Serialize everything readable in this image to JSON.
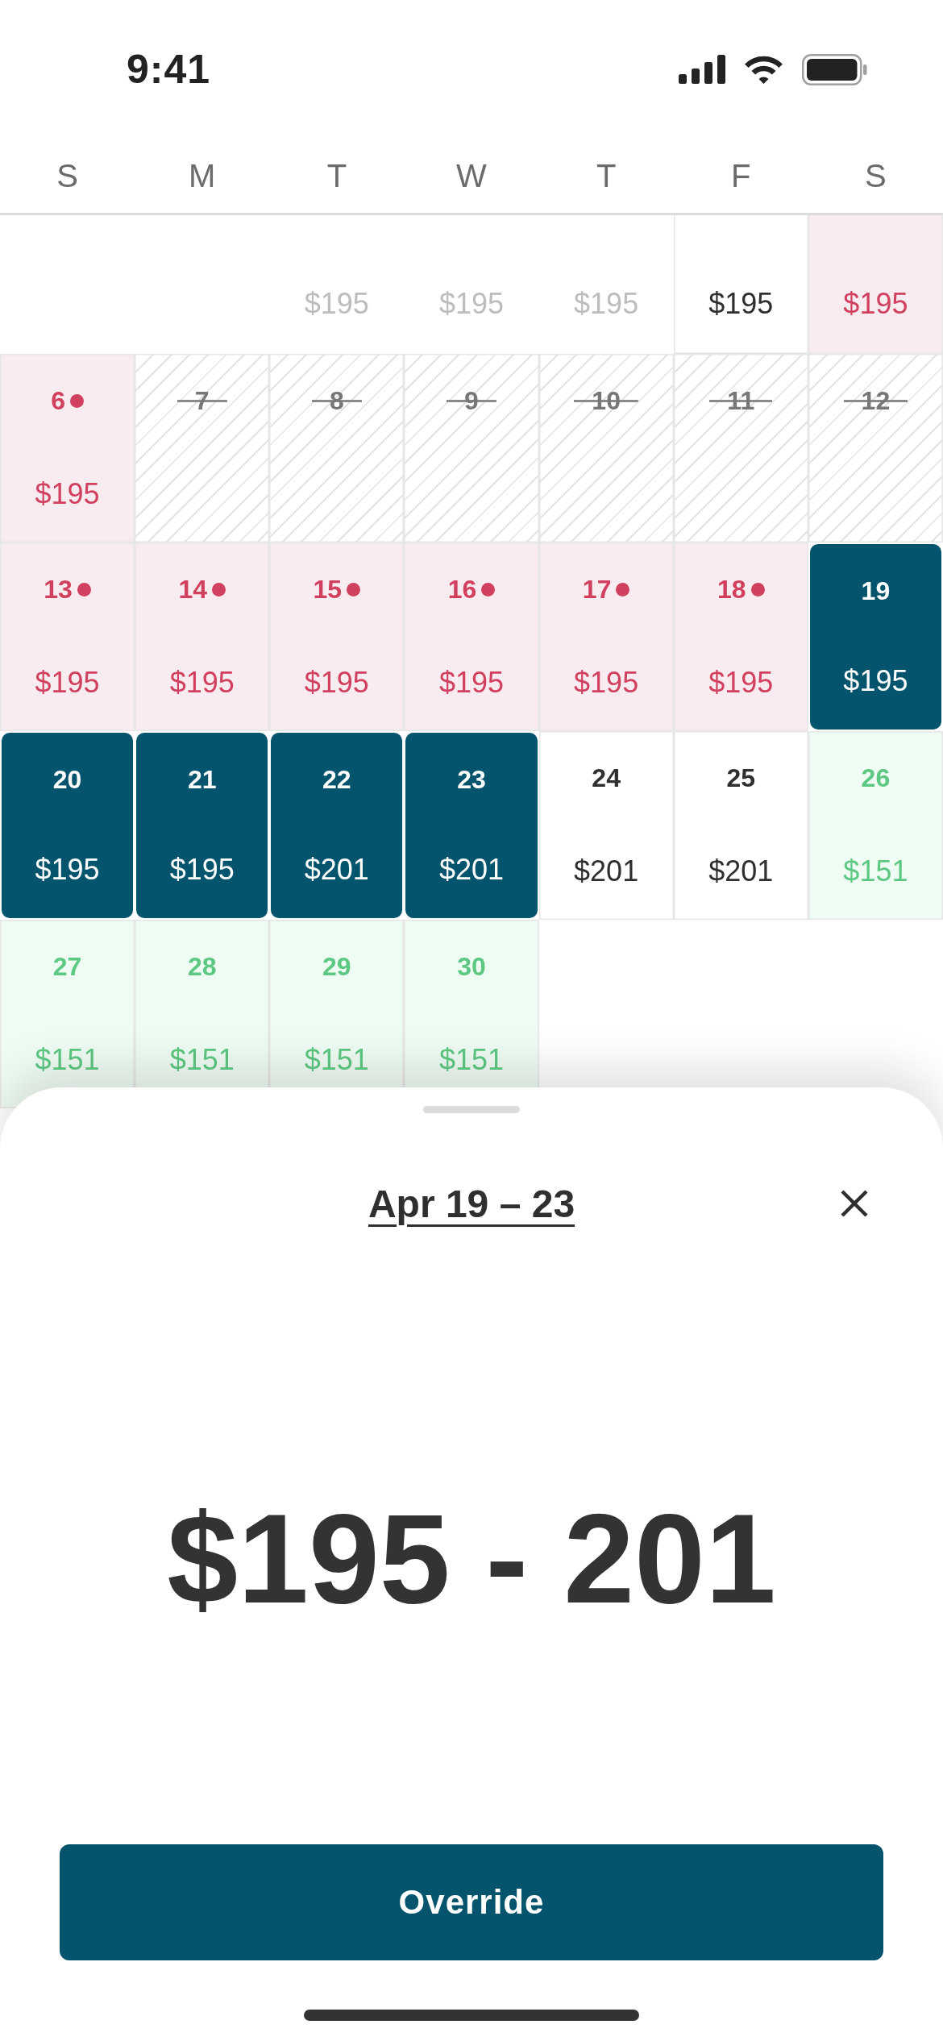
{
  "status_bar": {
    "time": "9:41"
  },
  "weekdays": [
    "S",
    "M",
    "T",
    "W",
    "T",
    "F",
    "S"
  ],
  "calendar": {
    "weeks": [
      [
        {
          "price": "$195",
          "kind": "past",
          "selected": false
        },
        {
          "price": "$195",
          "kind": "past",
          "selected": false
        },
        {
          "price": "$195",
          "kind": "past",
          "selected": false
        },
        {
          "price": "$195",
          "kind": "open",
          "selected": false
        },
        {
          "price": "$195",
          "kind": "booked",
          "selected": false
        }
      ],
      [
        {
          "day": "6",
          "price": "$195",
          "kind": "booked",
          "selected": false
        },
        {
          "day": "7",
          "kind": "blocked",
          "selected": false
        },
        {
          "day": "8",
          "kind": "blocked",
          "selected": false
        },
        {
          "day": "9",
          "kind": "blocked",
          "selected": false
        },
        {
          "day": "10",
          "kind": "blocked",
          "selected": false
        },
        {
          "day": "11",
          "kind": "blocked",
          "selected": false
        },
        {
          "day": "12",
          "kind": "blocked",
          "selected": false
        }
      ],
      [
        {
          "day": "13",
          "price": "$195",
          "kind": "booked",
          "selected": false
        },
        {
          "day": "14",
          "price": "$195",
          "kind": "booked",
          "selected": false
        },
        {
          "day": "15",
          "price": "$195",
          "kind": "booked",
          "selected": false
        },
        {
          "day": "16",
          "price": "$195",
          "kind": "booked",
          "selected": false
        },
        {
          "day": "17",
          "price": "$195",
          "kind": "booked",
          "selected": false
        },
        {
          "day": "18",
          "price": "$195",
          "kind": "booked",
          "selected": false
        },
        {
          "day": "19",
          "price": "$195",
          "kind": "open",
          "selected": true
        }
      ],
      [
        {
          "day": "20",
          "price": "$195",
          "kind": "open",
          "selected": true
        },
        {
          "day": "21",
          "price": "$195",
          "kind": "open",
          "selected": true
        },
        {
          "day": "22",
          "price": "$201",
          "kind": "open",
          "selected": true
        },
        {
          "day": "23",
          "price": "$201",
          "kind": "open",
          "selected": true
        },
        {
          "day": "24",
          "price": "$201",
          "kind": "open",
          "selected": false
        },
        {
          "day": "25",
          "price": "$201",
          "kind": "open",
          "selected": false
        },
        {
          "day": "26",
          "price": "$151",
          "kind": "discount",
          "selected": false
        }
      ],
      [
        {
          "day": "27",
          "price": "$151",
          "kind": "discount",
          "selected": false
        },
        {
          "day": "28",
          "price": "$151",
          "kind": "discount",
          "selected": false
        },
        {
          "day": "29",
          "price": "$151",
          "kind": "discount",
          "selected": false
        },
        {
          "day": "30",
          "price": "$151",
          "kind": "discount",
          "selected": false
        }
      ]
    ]
  },
  "sheet": {
    "title": "Apr 19 – 23",
    "price_range": "$195 - 201",
    "button": "Override"
  }
}
